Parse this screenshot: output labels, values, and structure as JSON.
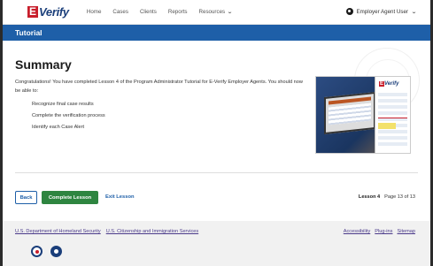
{
  "brand": {
    "logo_mark": "E",
    "logo_text": "Verify"
  },
  "nav": {
    "items": [
      "Home",
      "Cases",
      "Clients",
      "Reports"
    ],
    "resources_label": "Resources",
    "user_label": "Employer Agent User"
  },
  "titlebar": {
    "title": "Tutorial"
  },
  "summary": {
    "heading": "Summary",
    "intro": "Congratulations! You have completed Lesson 4 of the Program Administrator Tutorial for E-Verify Employer Agents. You should now be able to:",
    "bullets": [
      "Recognize final case results",
      "Complete the verification process",
      "Identify each Case Alert"
    ]
  },
  "illustration": {
    "brand_mark": "E",
    "brand_text": "Verify"
  },
  "actions": {
    "back_label": "Back",
    "complete_label": "Complete Lesson",
    "exit_label": "Exit Lesson",
    "lesson_label": "Lesson 4",
    "page_label": "Page 13 of 13"
  },
  "footer": {
    "left_links": [
      "U.S. Department of Homeland Security",
      "U.S. Citizenship and Immigration Services"
    ],
    "right_links": [
      "Accessibility",
      "Plug-ins",
      "Sitemap"
    ],
    "seals": [
      "dhs-seal-icon",
      "uscis-seal-icon"
    ]
  },
  "colors": {
    "brand_blue": "#1e5fa8",
    "complete_green": "#2e8540",
    "logo_red": "#c81e2b",
    "footer_link": "#4a3a8a"
  }
}
